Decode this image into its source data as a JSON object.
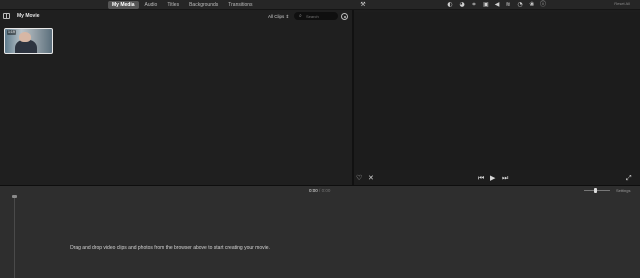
{
  "tabs": [
    {
      "label": "My Media",
      "active": true
    },
    {
      "label": "Audio",
      "active": false
    },
    {
      "label": "Titles",
      "active": false
    },
    {
      "label": "Backgrounds",
      "active": false
    },
    {
      "label": "Transitions",
      "active": false
    }
  ],
  "toolbar": {
    "icons": [
      "magic-wand-icon",
      "color-balance-icon",
      "color-correction-icon",
      "crop-icon",
      "stabilization-icon",
      "volume-icon",
      "noise-reduction-icon",
      "speed-icon",
      "clip-filter-icon",
      "info-icon"
    ],
    "reset_all_label": "Reset All"
  },
  "library": {
    "title": "My Movie",
    "filter_label": "All Clips",
    "search_placeholder": "Search",
    "clip": {
      "duration": "1:19"
    }
  },
  "viewer": {
    "controls": [
      "favorite-icon",
      "reject-icon",
      "skip-back-icon",
      "play-icon",
      "skip-forward-icon",
      "fullscreen-icon"
    ]
  },
  "timeline": {
    "current_time": "0:00",
    "separator": "/",
    "total_time": "0:00",
    "settings_label": "Settings",
    "empty_hint": "Drag and drop video clips and photos from the browser above to start creating your movie."
  },
  "colors": {
    "background": "#1e1e1e",
    "timeline_background": "#2e2e2e",
    "active_tab": "#555555"
  }
}
